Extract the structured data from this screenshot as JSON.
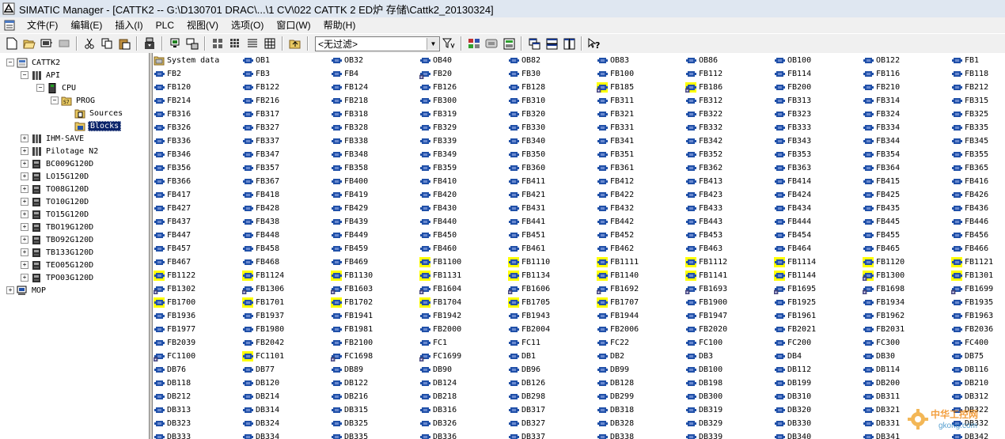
{
  "window": {
    "title": "SIMATIC Manager - [CATTK2 -- G:\\D130701 DRAC\\...\\1 CV\\022 CATTK 2 ED炉 存储\\Cattk2_20130324]"
  },
  "menu": [
    "文件(F)",
    "编辑(E)",
    "插入(I)",
    "PLC",
    "视图(V)",
    "选项(O)",
    "窗口(W)",
    "帮助(H)"
  ],
  "toolbar": {
    "filter_value": "<无过滤>",
    "buttons": [
      "new-icon",
      "open-icon",
      "accessible-nodes-icon",
      "memory-card-icon",
      "cut-icon",
      "copy-icon",
      "paste-icon",
      "download-icon",
      "online-icon",
      "offline-icon",
      "large-icons-icon",
      "small-icons-icon",
      "list-icon",
      "details-icon",
      "up-level-icon",
      "filter-icon",
      "simatic-manager-icon",
      "netpro-icon",
      "config-hw-icon",
      "window-cascade-icon",
      "window-tile-h-icon",
      "window-tile-v-icon",
      "help-icon"
    ]
  },
  "tree": [
    {
      "label": "CATTK2",
      "level": 0,
      "expander": "−",
      "icon": "project"
    },
    {
      "label": "API",
      "level": 1,
      "expander": "−",
      "icon": "station"
    },
    {
      "label": "CPU",
      "level": 2,
      "expander": "−",
      "icon": "cpu"
    },
    {
      "label": "PROG",
      "level": 3,
      "expander": "−",
      "icon": "program"
    },
    {
      "label": "Sources",
      "level": 4,
      "expander": "",
      "icon": "sources"
    },
    {
      "label": "Blocks",
      "level": 4,
      "expander": "",
      "icon": "blocks",
      "selected": true
    },
    {
      "label": "IHM-SAVE",
      "level": 1,
      "expander": "+",
      "icon": "station"
    },
    {
      "label": "Pilotage N2",
      "level": 1,
      "expander": "+",
      "icon": "station"
    },
    {
      "label": "BC009G120D",
      "level": 1,
      "expander": "+",
      "icon": "drive"
    },
    {
      "label": "LO15G120D",
      "level": 1,
      "expander": "+",
      "icon": "drive"
    },
    {
      "label": "TO08G120D",
      "level": 1,
      "expander": "+",
      "icon": "drive"
    },
    {
      "label": "TO10G120D",
      "level": 1,
      "expander": "+",
      "icon": "drive"
    },
    {
      "label": "TO15G120D",
      "level": 1,
      "expander": "+",
      "icon": "drive"
    },
    {
      "label": "TBO19G120D",
      "level": 1,
      "expander": "+",
      "icon": "drive"
    },
    {
      "label": "TBO92G120D",
      "level": 1,
      "expander": "+",
      "icon": "drive"
    },
    {
      "label": "TB133G120D",
      "level": 1,
      "expander": "+",
      "icon": "drive"
    },
    {
      "label": "TEO05G120D",
      "level": 1,
      "expander": "+",
      "icon": "drive"
    },
    {
      "label": "TPO03G120D",
      "level": 1,
      "expander": "+",
      "icon": "drive"
    },
    {
      "label": "MOP",
      "level": 0,
      "expander": "+",
      "icon": "pc"
    }
  ],
  "blocks": [
    [
      "System data",
      "OB1",
      "OB32",
      "OB40",
      "OB82",
      "OB83",
      "OB86",
      "OB100",
      "OB122",
      "FB1"
    ],
    [
      "FB2",
      "FB3",
      "FB4",
      "FB20",
      "FB30",
      "FB100",
      "FB112",
      "FB114",
      "FB116",
      "FB118"
    ],
    [
      "FB120",
      "FB122",
      "FB124",
      "FB126",
      "FB128",
      "FB185",
      "FB186",
      "FB200",
      "FB210",
      "FB212"
    ],
    [
      "FB214",
      "FB216",
      "FB218",
      "FB300",
      "FB310",
      "FB311",
      "FB312",
      "FB313",
      "FB314",
      "FB315"
    ],
    [
      "FB316",
      "FB317",
      "FB318",
      "FB319",
      "FB320",
      "FB321",
      "FB322",
      "FB323",
      "FB324",
      "FB325"
    ],
    [
      "FB326",
      "FB327",
      "FB328",
      "FB329",
      "FB330",
      "FB331",
      "FB332",
      "FB333",
      "FB334",
      "FB335"
    ],
    [
      "FB336",
      "FB337",
      "FB338",
      "FB339",
      "FB340",
      "FB341",
      "FB342",
      "FB343",
      "FB344",
      "FB345"
    ],
    [
      "FB346",
      "FB347",
      "FB348",
      "FB349",
      "FB350",
      "FB351",
      "FB352",
      "FB353",
      "FB354",
      "FB355"
    ],
    [
      "FB356",
      "FB357",
      "FB358",
      "FB359",
      "FB360",
      "FB361",
      "FB362",
      "FB363",
      "FB364",
      "FB365"
    ],
    [
      "FB366",
      "FB367",
      "FB400",
      "FB410",
      "FB411",
      "FB412",
      "FB413",
      "FB414",
      "FB415",
      "FB416"
    ],
    [
      "FB417",
      "FB418",
      "FB419",
      "FB420",
      "FB421",
      "FB422",
      "FB423",
      "FB424",
      "FB425",
      "FB426"
    ],
    [
      "FB427",
      "FB428",
      "FB429",
      "FB430",
      "FB431",
      "FB432",
      "FB433",
      "FB434",
      "FB435",
      "FB436"
    ],
    [
      "FB437",
      "FB438",
      "FB439",
      "FB440",
      "FB441",
      "FB442",
      "FB443",
      "FB444",
      "FB445",
      "FB446"
    ],
    [
      "FB447",
      "FB448",
      "FB449",
      "FB450",
      "FB451",
      "FB452",
      "FB453",
      "FB454",
      "FB455",
      "FB456"
    ],
    [
      "FB457",
      "FB458",
      "FB459",
      "FB460",
      "FB461",
      "FB462",
      "FB463",
      "FB464",
      "FB465",
      "FB466"
    ],
    [
      "FB467",
      "FB468",
      "FB469",
      "FB1100",
      "FB1110",
      "FB1111",
      "FB1112",
      "FB1114",
      "FB1120",
      "FB1121"
    ],
    [
      "FB1122",
      "FB1124",
      "FB1130",
      "FB1131",
      "FB1134",
      "FB1140",
      "FB1141",
      "FB1144",
      "FB1300",
      "FB1301"
    ],
    [
      "FB1302",
      "FB1306",
      "FB1603",
      "FB1604",
      "FB1606",
      "FB1692",
      "FB1693",
      "FB1695",
      "FB1698",
      "FB1699"
    ],
    [
      "FB1700",
      "FB1701",
      "FB1702",
      "FB1704",
      "FB1705",
      "FB1707",
      "FB1900",
      "FB1925",
      "FB1934",
      "FB1935"
    ],
    [
      "FB1936",
      "FB1937",
      "FB1941",
      "FB1942",
      "FB1943",
      "FB1944",
      "FB1947",
      "FB1961",
      "FB1962",
      "FB1963"
    ],
    [
      "FB1977",
      "FB1980",
      "FB1981",
      "FB2000",
      "FB2004",
      "FB2006",
      "FB2020",
      "FB2021",
      "FB2031",
      "FB2036"
    ],
    [
      "FB2039",
      "FB2042",
      "FB2100",
      "FC1",
      "FC11",
      "FC22",
      "FC100",
      "FC200",
      "FC300",
      "FC400"
    ],
    [
      "FC1100",
      "FC1101",
      "FC1698",
      "FC1699",
      "DB1",
      "DB2",
      "DB3",
      "DB4",
      "DB30",
      "DB75"
    ],
    [
      "DB76",
      "DB77",
      "DB89",
      "DB90",
      "DB96",
      "DB99",
      "DB100",
      "DB112",
      "DB114",
      "DB116"
    ],
    [
      "DB118",
      "DB120",
      "DB122",
      "DB124",
      "DB126",
      "DB128",
      "DB198",
      "DB199",
      "DB200",
      "DB210"
    ],
    [
      "DB212",
      "DB214",
      "DB216",
      "DB218",
      "DB298",
      "DB299",
      "DB300",
      "DB310",
      "DB311",
      "DB312"
    ],
    [
      "DB313",
      "DB314",
      "DB315",
      "DB316",
      "DB317",
      "DB318",
      "DB319",
      "DB320",
      "DB321",
      "DB322"
    ],
    [
      "DB323",
      "DB324",
      "DB325",
      "DB326",
      "DB327",
      "DB328",
      "DB329",
      "DB330",
      "DB331",
      "DB332"
    ],
    [
      "DB333",
      "DB334",
      "DB335",
      "DB336",
      "DB337",
      "DB338",
      "DB339",
      "DB340",
      "DB341",
      "DB342"
    ]
  ],
  "highlighted_blocks": [
    "FB185",
    "FB186",
    "FB1100",
    "FB1110",
    "FB1111",
    "FB1112",
    "FB1114",
    "FB1120",
    "FB1121",
    "FB1122",
    "FB1124",
    "FB1130",
    "FB1131",
    "FB1134",
    "FB1140",
    "FB1141",
    "FB1144",
    "FB1300",
    "FB1301",
    "FB1700",
    "FB1701",
    "FB1702",
    "FB1704",
    "FB1705",
    "FB1707",
    "FC1101"
  ],
  "lock_blocks": [
    "FB20",
    "FB185",
    "FB186",
    "FB1300",
    "FB1302",
    "FB1306",
    "FB1603",
    "FB1604",
    "FB1606",
    "FB1692",
    "FB1693",
    "FB1695",
    "FB1698",
    "FB1699",
    "FC1100",
    "FC1698",
    "FC1699"
  ],
  "watermark": {
    "text": "中华工控网",
    "sub": "gkong.com"
  },
  "colors": {
    "selection": "#0a246a",
    "highlight": "#ffff00",
    "block_blue": "#2050a8"
  }
}
